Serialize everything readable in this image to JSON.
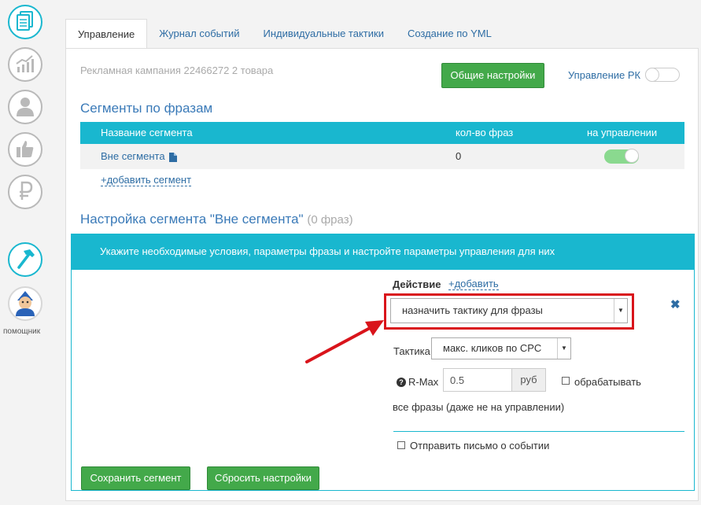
{
  "sidebar": {
    "items": [
      {
        "icon": "documents-icon",
        "active": true
      },
      {
        "icon": "chart-growth-icon",
        "active": false
      },
      {
        "icon": "user-icon",
        "active": false
      },
      {
        "icon": "thumbs-up-icon",
        "active": false
      },
      {
        "icon": "ruble-icon",
        "active": false
      },
      {
        "icon": "hammer-icon",
        "active": true
      }
    ],
    "assistant_label": "помощник"
  },
  "tabs": [
    {
      "label": "Управление",
      "active": true
    },
    {
      "label": "Журнал событий",
      "active": false
    },
    {
      "label": "Индивидуальные тактики",
      "active": false
    },
    {
      "label": "Создание по YML",
      "active": false
    }
  ],
  "header": {
    "campaign": "Рекламная кампания 22466272 2 товара",
    "general_settings": "Общие настройки",
    "manage_rk_label": "Управление РК",
    "manage_rk_on": false
  },
  "segments": {
    "title": "Сегменты по фразам",
    "columns": [
      "Название сегмента",
      "кол-во фраз",
      "на управлении"
    ],
    "rows": [
      {
        "name": "Вне сегмента",
        "count": "0",
        "managed": true
      }
    ],
    "add_label": "+добавить сегмент"
  },
  "config": {
    "title": "Настройка сегмента \"Вне сегмента\"",
    "phrases_count": "(0 фраз)",
    "banner": "Укажите необходимые условия, параметры фразы и настройте параметры управления для них",
    "action_label": "Действие",
    "action_add": "+добавить",
    "action_value": "назначить тактику для фразы",
    "tactic_label": "Тактика",
    "tactic_value": "макс. кликов по CPC",
    "help_symbol": "?",
    "rmax_label": "R-Max",
    "rmax_value": "0.5",
    "rmax_unit": "руб",
    "process_all_label": "обрабатывать",
    "process_all_cont": "все фразы (даже не на управлении)",
    "send_email_label": "Отправить письмо о событии"
  },
  "buttons": {
    "save": "Сохранить сегмент",
    "reset": "Сбросить настройки"
  },
  "colors": {
    "accent": "#19b7cf",
    "green": "#43a94a",
    "link": "#2e6da4",
    "highlight": "#d9141b",
    "toggle_on": "#8ad98f"
  }
}
